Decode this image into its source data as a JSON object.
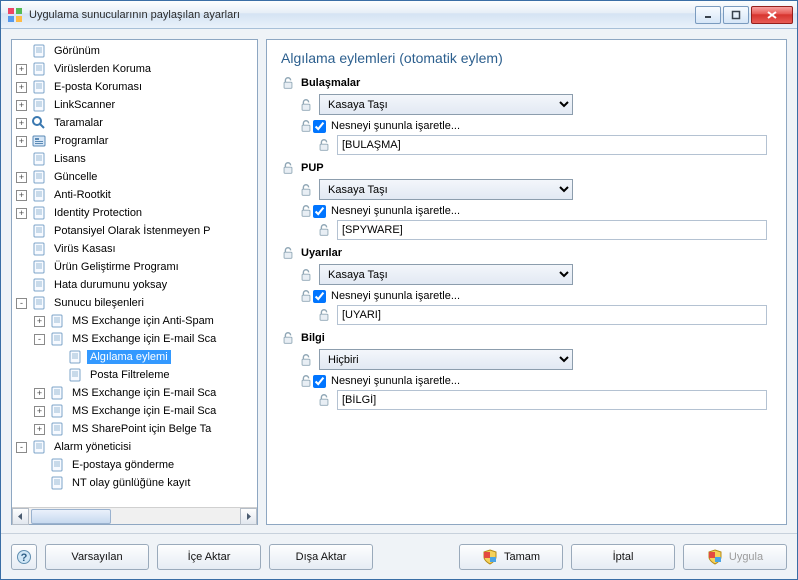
{
  "window": {
    "title": "Uygulama sunucularının paylaşılan ayarları"
  },
  "tree": {
    "items": [
      {
        "depth": 0,
        "exp": " ",
        "icon": "page",
        "label": "Görünüm"
      },
      {
        "depth": 0,
        "exp": "+",
        "icon": "page",
        "label": "Virüslerden Koruma"
      },
      {
        "depth": 0,
        "exp": "+",
        "icon": "page",
        "label": "E-posta Koruması"
      },
      {
        "depth": 0,
        "exp": "+",
        "icon": "page",
        "label": "LinkScanner"
      },
      {
        "depth": 0,
        "exp": "+",
        "icon": "scan",
        "label": "Taramalar"
      },
      {
        "depth": 0,
        "exp": "+",
        "icon": "prog",
        "label": "Programlar"
      },
      {
        "depth": 0,
        "exp": " ",
        "icon": "page",
        "label": "Lisans"
      },
      {
        "depth": 0,
        "exp": "+",
        "icon": "page",
        "label": "Güncelle"
      },
      {
        "depth": 0,
        "exp": "+",
        "icon": "page",
        "label": "Anti-Rootkit"
      },
      {
        "depth": 0,
        "exp": "+",
        "icon": "page",
        "label": "Identity Protection"
      },
      {
        "depth": 0,
        "exp": " ",
        "icon": "page",
        "label": "Potansiyel Olarak İstenmeyen P"
      },
      {
        "depth": 0,
        "exp": " ",
        "icon": "page",
        "label": "Virüs Kasası"
      },
      {
        "depth": 0,
        "exp": " ",
        "icon": "page",
        "label": "Ürün Geliştirme Programı"
      },
      {
        "depth": 0,
        "exp": " ",
        "icon": "page",
        "label": "Hata durumunu yoksay"
      },
      {
        "depth": 0,
        "exp": "-",
        "icon": "page",
        "label": "Sunucu bileşenleri"
      },
      {
        "depth": 1,
        "exp": "+",
        "icon": "page",
        "label": "MS Exchange için Anti-Spam"
      },
      {
        "depth": 1,
        "exp": "-",
        "icon": "page",
        "label": "MS Exchange için E-mail Sca"
      },
      {
        "depth": 2,
        "exp": " ",
        "icon": "page",
        "label": "Algılama eylemi",
        "selected": true
      },
      {
        "depth": 2,
        "exp": " ",
        "icon": "page",
        "label": "Posta Filtreleme"
      },
      {
        "depth": 1,
        "exp": "+",
        "icon": "page",
        "label": "MS Exchange için E-mail Sca"
      },
      {
        "depth": 1,
        "exp": "+",
        "icon": "page",
        "label": "MS Exchange için E-mail Sca"
      },
      {
        "depth": 1,
        "exp": "+",
        "icon": "page",
        "label": "MS SharePoint için Belge Ta"
      },
      {
        "depth": 0,
        "exp": "-",
        "icon": "page",
        "label": "Alarm yöneticisi"
      },
      {
        "depth": 1,
        "exp": " ",
        "icon": "page",
        "label": "E-postaya gönderme"
      },
      {
        "depth": 1,
        "exp": " ",
        "icon": "page",
        "label": "NT olay günlüğüne kayıt"
      }
    ]
  },
  "panel": {
    "heading": "Algılama eylemleri (otomatik eylem)",
    "sections": [
      {
        "title": "Bulaşmalar",
        "combo": "Kasaya Taşı",
        "chk": "Nesneyi şununla işaretle...",
        "text": "[BULAŞMA]"
      },
      {
        "title": "PUP",
        "combo": "Kasaya Taşı",
        "chk": "Nesneyi şununla işaretle...",
        "text": "[SPYWARE]"
      },
      {
        "title": "Uyarılar",
        "combo": "Kasaya Taşı",
        "chk": "Nesneyi şununla işaretle...",
        "text": "[UYARI]"
      },
      {
        "title": "Bilgi",
        "combo": "Hiçbiri",
        "chk": "Nesneyi şununla işaretle...",
        "text": "[BİLGİ]"
      }
    ]
  },
  "footer": {
    "defaults": "Varsayılan",
    "import": "İçe Aktar",
    "export": "Dışa Aktar",
    "ok": "Tamam",
    "cancel": "İptal",
    "apply": "Uygula"
  }
}
